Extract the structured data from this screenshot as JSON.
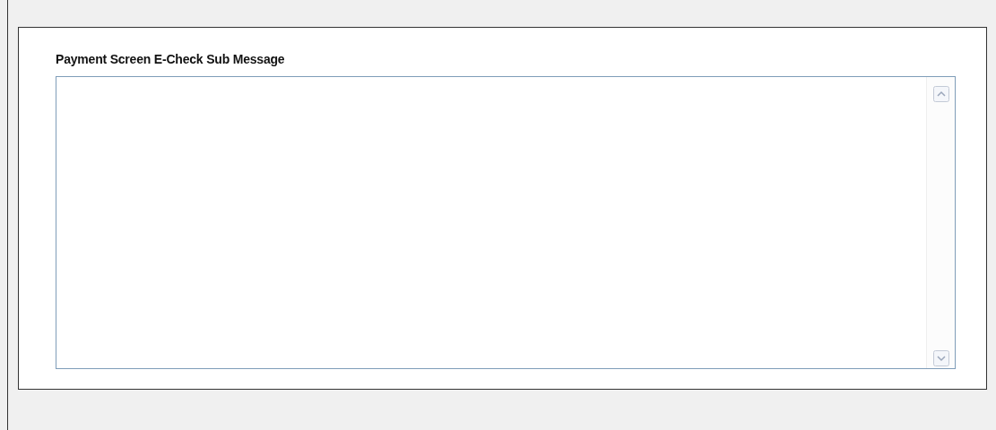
{
  "message_field": {
    "label": "Payment Screen E-Check Sub Message"
  }
}
